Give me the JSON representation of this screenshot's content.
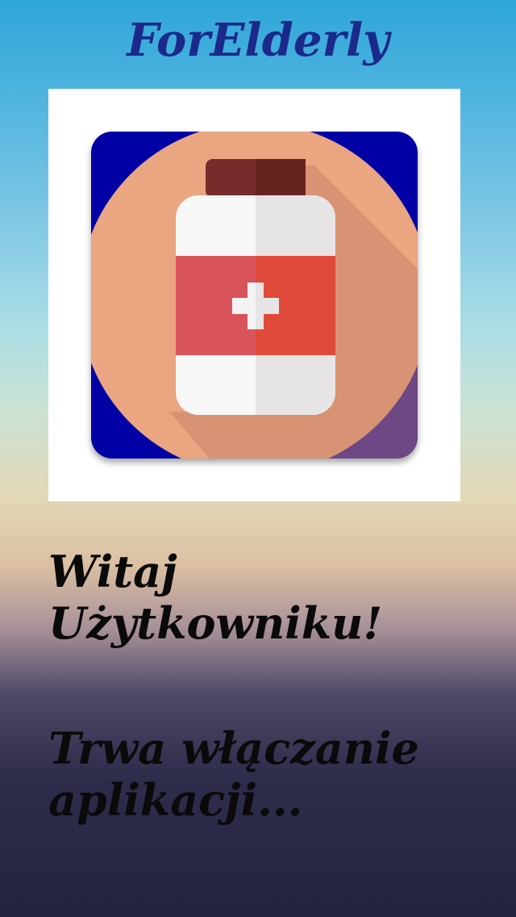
{
  "app": {
    "title": "ForElderly"
  },
  "logo": {
    "icon": "medicine-bottle-icon",
    "background_color": "#0505a5",
    "circle_color": "#e9a681",
    "cap_color": "#762c2a",
    "label_color": "#e04a3a",
    "bottle_color": "#f5f5f5"
  },
  "welcome": {
    "line1": "Witaj",
    "line2": "Użytkowniku!"
  },
  "status": {
    "line1": "Trwa włączanie",
    "line2": "aplikacji..."
  }
}
